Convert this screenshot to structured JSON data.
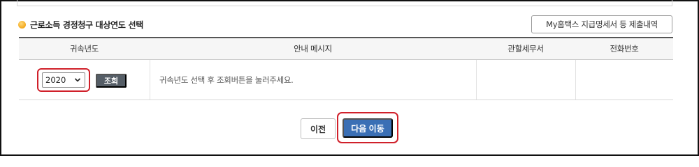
{
  "section": {
    "title": "근로소득 경정청구 대상연도 선택",
    "report_button": "My홈택스 지급명세서 등 제출내역"
  },
  "table": {
    "headers": [
      "귀속년도",
      "안내 메시지",
      "관할세무서",
      "전화번호"
    ],
    "year_select": {
      "value": "2020"
    },
    "search_button": "조회",
    "message": "귀속년도 선택 후 조회버튼을 눌러주세요.",
    "tax_office": "",
    "phone": ""
  },
  "footer": {
    "prev_button": "이전",
    "next_button": "다음 이동"
  },
  "colors": {
    "primary": "#3a6fb5",
    "highlight": "#d0202a",
    "search_button": "#555d66",
    "bullet": "#f3a81c"
  }
}
